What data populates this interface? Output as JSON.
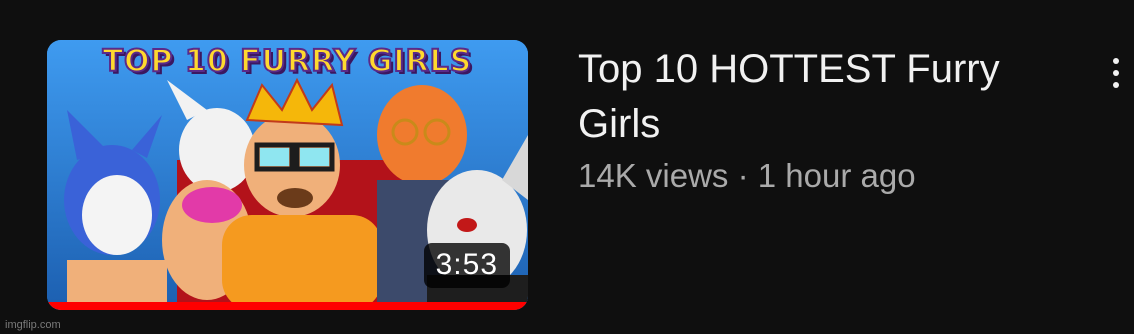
{
  "video": {
    "thumbnail_text": "TOP 10 FURRY GIRLS",
    "duration": "3:53",
    "title": "Top 10 HOTTEST Furry Girls",
    "views": "14K views",
    "separator": "·",
    "uploaded": "1 hour ago",
    "watch_progress": 1.0,
    "more_icon": "vertical-ellipsis-icon"
  },
  "watermark": "imgflip.com",
  "colors": {
    "background": "#0f0f0f",
    "title_text": "#f1f1f1",
    "meta_text": "#aaaaaa",
    "progress": "#ff0000",
    "thumbnail_text": "#ffd92e"
  }
}
